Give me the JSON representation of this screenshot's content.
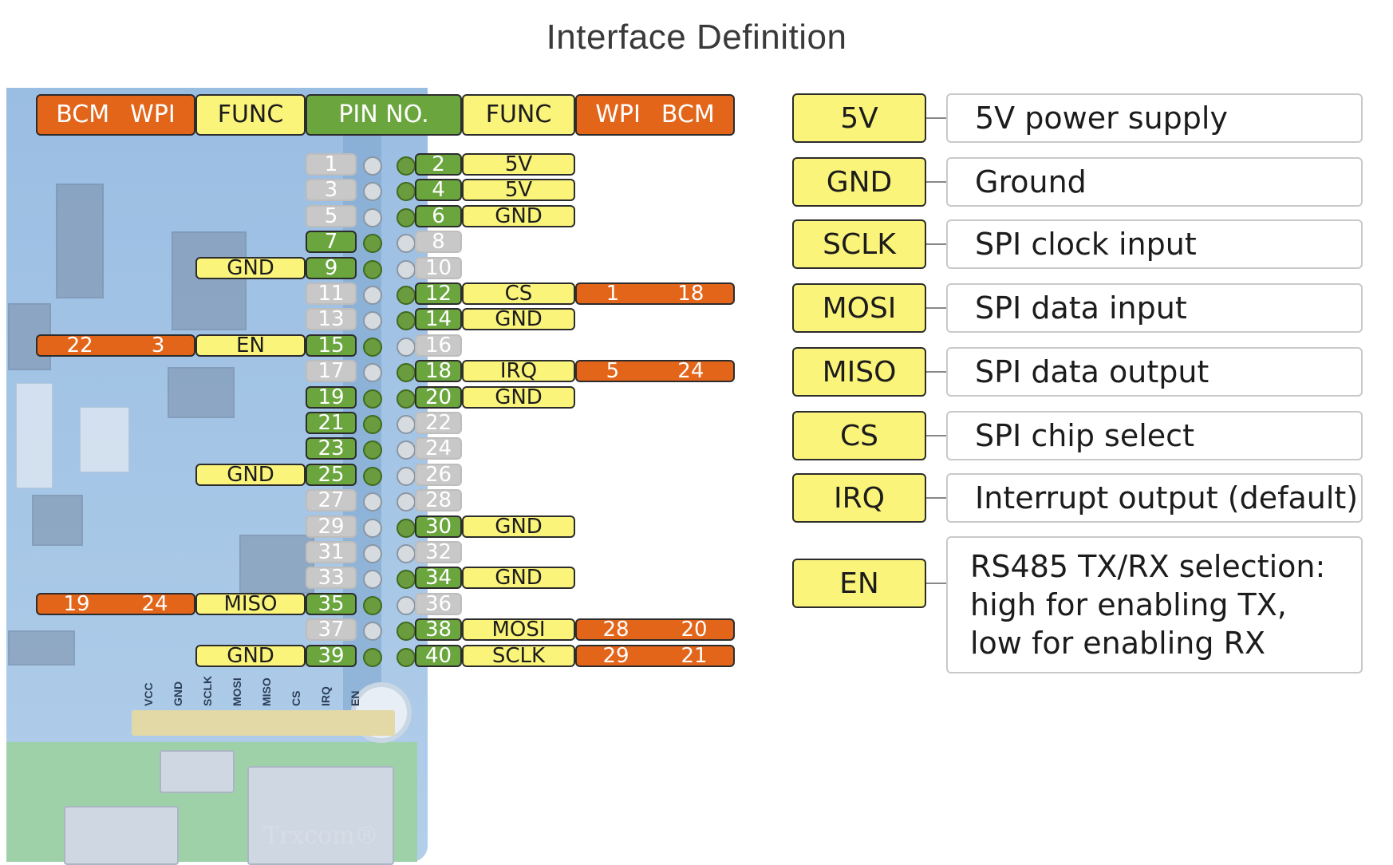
{
  "title": "Interface Definition",
  "header": {
    "left_bcm": "BCM",
    "left_wpi": "WPI",
    "left_func": "FUNC",
    "pin_no": "PIN NO.",
    "right_func": "FUNC",
    "right_wpi": "WPI",
    "right_bcm": "BCM"
  },
  "left_rows": [
    {
      "pin": "1",
      "active": false,
      "func": "",
      "bcm": "",
      "wpi": ""
    },
    {
      "pin": "3",
      "active": false,
      "func": "",
      "bcm": "",
      "wpi": ""
    },
    {
      "pin": "5",
      "active": false,
      "func": "",
      "bcm": "",
      "wpi": ""
    },
    {
      "pin": "7",
      "active": true,
      "func": "",
      "bcm": "",
      "wpi": ""
    },
    {
      "pin": "9",
      "active": true,
      "func": "GND",
      "bcm": "",
      "wpi": ""
    },
    {
      "pin": "11",
      "active": false,
      "func": "",
      "bcm": "",
      "wpi": ""
    },
    {
      "pin": "13",
      "active": false,
      "func": "",
      "bcm": "",
      "wpi": ""
    },
    {
      "pin": "15",
      "active": true,
      "func": "EN",
      "bcm": "22",
      "wpi": "3"
    },
    {
      "pin": "17",
      "active": false,
      "func": "",
      "bcm": "",
      "wpi": ""
    },
    {
      "pin": "19",
      "active": true,
      "func": "",
      "bcm": "",
      "wpi": ""
    },
    {
      "pin": "21",
      "active": true,
      "func": "",
      "bcm": "",
      "wpi": ""
    },
    {
      "pin": "23",
      "active": true,
      "func": "",
      "bcm": "",
      "wpi": ""
    },
    {
      "pin": "25",
      "active": true,
      "func": "GND",
      "bcm": "",
      "wpi": ""
    },
    {
      "pin": "27",
      "active": false,
      "func": "",
      "bcm": "",
      "wpi": ""
    },
    {
      "pin": "29",
      "active": false,
      "func": "",
      "bcm": "",
      "wpi": ""
    },
    {
      "pin": "31",
      "active": false,
      "func": "",
      "bcm": "",
      "wpi": ""
    },
    {
      "pin": "33",
      "active": false,
      "func": "",
      "bcm": "",
      "wpi": ""
    },
    {
      "pin": "35",
      "active": true,
      "func": "MISO",
      "bcm": "19",
      "wpi": "24"
    },
    {
      "pin": "37",
      "active": false,
      "func": "",
      "bcm": "",
      "wpi": ""
    },
    {
      "pin": "39",
      "active": true,
      "func": "GND",
      "bcm": "",
      "wpi": ""
    }
  ],
  "right_rows": [
    {
      "pin": "2",
      "active": true,
      "func": "5V",
      "wpi": "",
      "bcm": ""
    },
    {
      "pin": "4",
      "active": true,
      "func": "5V",
      "wpi": "",
      "bcm": ""
    },
    {
      "pin": "6",
      "active": true,
      "func": "GND",
      "wpi": "",
      "bcm": ""
    },
    {
      "pin": "8",
      "active": false,
      "func": "",
      "wpi": "",
      "bcm": ""
    },
    {
      "pin": "10",
      "active": false,
      "func": "",
      "wpi": "",
      "bcm": ""
    },
    {
      "pin": "12",
      "active": true,
      "func": "CS",
      "wpi": "1",
      "bcm": "18"
    },
    {
      "pin": "14",
      "active": true,
      "func": "GND",
      "wpi": "",
      "bcm": ""
    },
    {
      "pin": "16",
      "active": false,
      "func": "",
      "wpi": "",
      "bcm": ""
    },
    {
      "pin": "18",
      "active": true,
      "func": "IRQ",
      "wpi": "5",
      "bcm": "24"
    },
    {
      "pin": "20",
      "active": true,
      "func": "GND",
      "wpi": "",
      "bcm": ""
    },
    {
      "pin": "22",
      "active": false,
      "func": "",
      "wpi": "",
      "bcm": ""
    },
    {
      "pin": "24",
      "active": false,
      "func": "",
      "wpi": "",
      "bcm": ""
    },
    {
      "pin": "26",
      "active": false,
      "func": "",
      "wpi": "",
      "bcm": ""
    },
    {
      "pin": "28",
      "active": false,
      "func": "",
      "wpi": "",
      "bcm": ""
    },
    {
      "pin": "30",
      "active": true,
      "func": "GND",
      "wpi": "",
      "bcm": ""
    },
    {
      "pin": "32",
      "active": false,
      "func": "",
      "wpi": "",
      "bcm": ""
    },
    {
      "pin": "34",
      "active": true,
      "func": "GND",
      "wpi": "",
      "bcm": ""
    },
    {
      "pin": "36",
      "active": false,
      "func": "",
      "wpi": "",
      "bcm": ""
    },
    {
      "pin": "38",
      "active": true,
      "func": "MOSI",
      "wpi": "28",
      "bcm": "20"
    },
    {
      "pin": "40",
      "active": true,
      "func": "SCLK",
      "wpi": "29",
      "bcm": "21"
    }
  ],
  "legend": [
    {
      "key": "5V",
      "lines": [
        "5V power supply"
      ]
    },
    {
      "key": "GND",
      "lines": [
        "Ground"
      ]
    },
    {
      "key": "SCLK",
      "lines": [
        "SPI clock input"
      ]
    },
    {
      "key": "MOSI",
      "lines": [
        "SPI data input"
      ]
    },
    {
      "key": "MISO",
      "lines": [
        "SPI data output"
      ]
    },
    {
      "key": "CS",
      "lines": [
        "SPI chip select"
      ]
    },
    {
      "key": "IRQ",
      "lines": [
        "Interrupt output (default)"
      ]
    },
    {
      "key": "EN",
      "lines": [
        "RS485 TX/RX selection:",
        "high for enabling TX,",
        "low for enabling RX"
      ]
    }
  ],
  "board_labels": [
    "VCC",
    "GND",
    "SCLK",
    "MOSI",
    "MISO",
    "CS",
    "IRQ",
    "EN"
  ],
  "colors": {
    "func": "#fbf47a",
    "gpio": "#e2651a",
    "pin_active": "#6aa63d",
    "pin_inactive": "#c8c8c8"
  }
}
